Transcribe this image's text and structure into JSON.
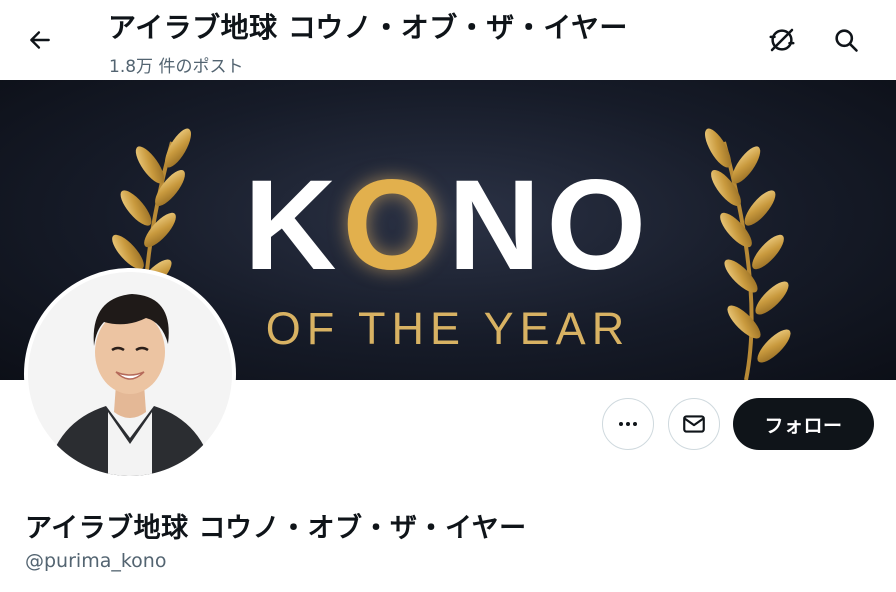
{
  "header": {
    "title": "アイラブ地球 コウノ・オブ・ザ・イヤー",
    "post_count": "1.8万 件のポスト"
  },
  "banner": {
    "headline_pre": "K",
    "headline_highlight": "O",
    "headline_post": "NO",
    "subline": "OF THE YEAR",
    "background_color": "#161b28",
    "gold_color": "#d8b263"
  },
  "profile": {
    "display_name": "アイラブ地球 コウノ・オブ・ザ・イヤー",
    "handle": "@purima_kono"
  },
  "actions": {
    "follow_label": "フォロー"
  },
  "icons": {
    "back": "arrow-left-icon",
    "translate": "translate-off-icon",
    "search": "search-icon",
    "more": "more-horizontal-icon",
    "message": "envelope-icon"
  }
}
